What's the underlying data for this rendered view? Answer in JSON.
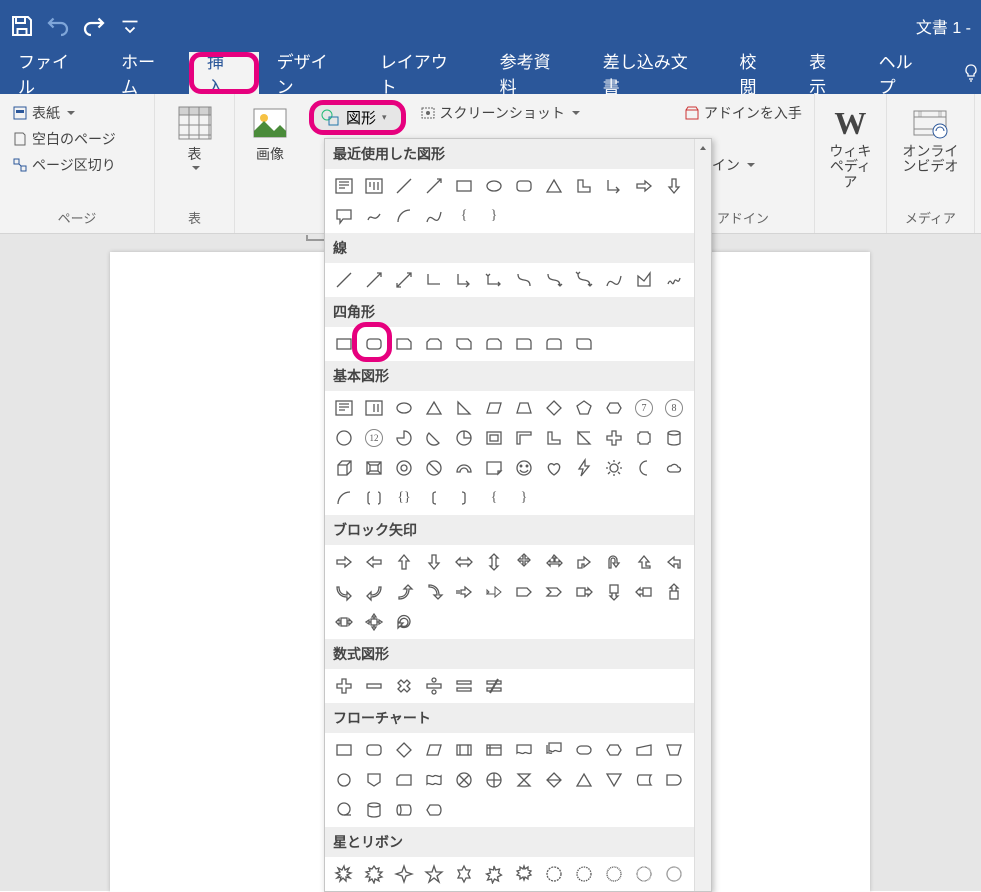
{
  "titlebar": {
    "doc_title": "文書 1  -  "
  },
  "menu_tabs": {
    "file": "ファイル",
    "home": "ホーム",
    "insert": "挿入",
    "design": "デザイン",
    "layout": "レイアウト",
    "references": "参考資料",
    "mailmerge": "差し込み文書",
    "review": "校閲",
    "view": "表示",
    "help": "ヘルプ"
  },
  "ribbon": {
    "pages": {
      "cover": "表紙",
      "blank": "空白のページ",
      "break": "ページ区切り",
      "label": "ページ"
    },
    "tables": {
      "table": "表",
      "label": "表"
    },
    "images": {
      "picture": "画像"
    },
    "illustrations": {
      "shapes": "図形",
      "screenshot": "スクリーンショット"
    },
    "addins": {
      "get": "アドインを入手",
      "my": "アドイン",
      "label": "アドイン"
    },
    "wikipedia": {
      "label": "ウィキペディア"
    },
    "media": {
      "onlinevideo": "オンラインビデオ",
      "label": "メディア"
    }
  },
  "shapes_panel": {
    "headers": {
      "recent": "最近使用した図形",
      "lines": "線",
      "rect": "四角形",
      "basic": "基本図形",
      "blockarrows": "ブロック矢印",
      "equation": "数式図形",
      "flowchart": "フローチャート",
      "stars": "星とリボン"
    },
    "braces": {
      "open": "{",
      "close": "}"
    },
    "circled": {
      "n7": "7",
      "n8": "8",
      "n12": "12"
    }
  },
  "highlight_color": "#e6007e"
}
